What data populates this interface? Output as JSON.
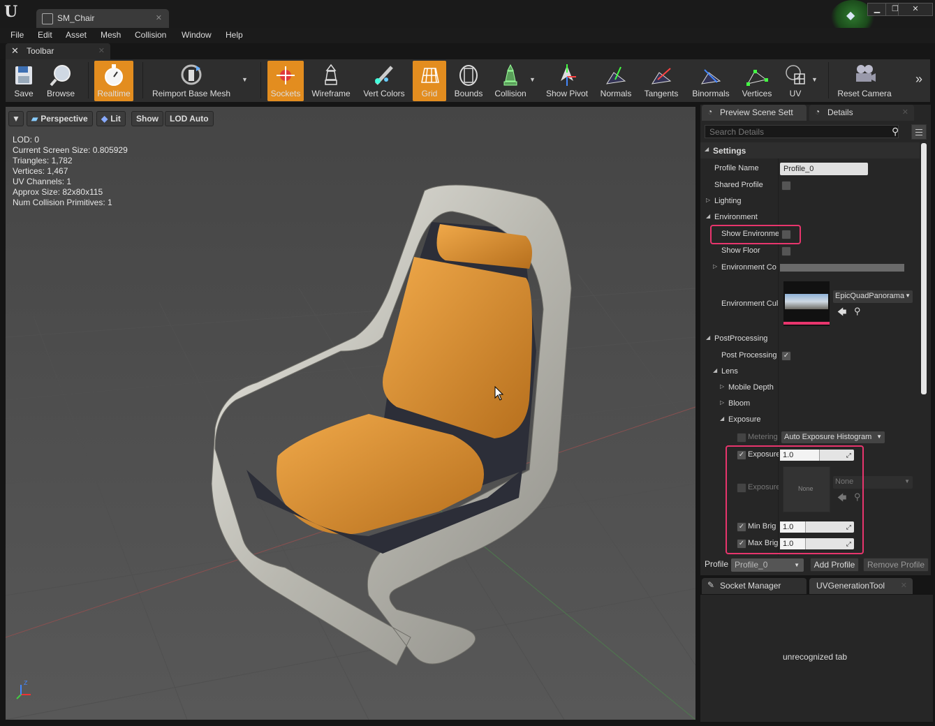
{
  "app": {
    "document_tab": "SM_Chair"
  },
  "menu": [
    "File",
    "Edit",
    "Asset",
    "Mesh",
    "Collision",
    "Window",
    "Help"
  ],
  "toolbar_tab": "Toolbar",
  "toolbar": [
    {
      "label": "Save",
      "icon": "save-icon",
      "active": false
    },
    {
      "label": "Browse",
      "icon": "browse-icon",
      "active": false
    },
    {
      "label": "Realtime",
      "icon": "realtime-icon",
      "active": true
    },
    {
      "label": "Reimport Base Mesh",
      "icon": "reimport-icon",
      "active": false
    },
    {
      "label": "Sockets",
      "icon": "sockets-icon",
      "active": true
    },
    {
      "label": "Wireframe",
      "icon": "wireframe-icon",
      "active": false
    },
    {
      "label": "Vert Colors",
      "icon": "vert-colors-icon",
      "active": false
    },
    {
      "label": "Grid",
      "icon": "grid-icon",
      "active": true
    },
    {
      "label": "Bounds",
      "icon": "bounds-icon",
      "active": false
    },
    {
      "label": "Collision",
      "icon": "collision-icon",
      "active": false
    },
    {
      "label": "Show Pivot",
      "icon": "pivot-icon",
      "active": false
    },
    {
      "label": "Normals",
      "icon": "normals-icon",
      "active": false
    },
    {
      "label": "Tangents",
      "icon": "tangents-icon",
      "active": false
    },
    {
      "label": "Binormals",
      "icon": "binormals-icon",
      "active": false
    },
    {
      "label": "Vertices",
      "icon": "vertices-icon",
      "active": false
    },
    {
      "label": "UV",
      "icon": "uv-icon",
      "active": false
    },
    {
      "label": "Reset Camera",
      "icon": "camera-icon",
      "active": false
    }
  ],
  "viewport": {
    "buttons": {
      "perspective": "Perspective",
      "lit": "Lit",
      "show": "Show",
      "lod": "LOD Auto"
    },
    "stats": [
      "LOD:  0",
      "Current Screen Size:  0.805929",
      "Triangles:  1,782",
      "Vertices:  1,467",
      "UV Channels:  1",
      "Approx Size: 82x80x115",
      "Num Collision Primitives:  1"
    ]
  },
  "panel": {
    "tabs": {
      "preview": "Preview Scene Sett",
      "details": "Details"
    },
    "search_placeholder": "Search Details",
    "settings_header": "Settings",
    "profile_name_label": "Profile Name",
    "profile_name_value": "Profile_0",
    "shared_profile_label": "Shared Profile",
    "lighting": "Lighting",
    "environment": "Environment",
    "show_environment": "Show Environme",
    "show_floor": "Show Floor",
    "environment_color": "Environment Co",
    "environment_cube": "Environment Cul",
    "cube_asset": "EpicQuadPanorama",
    "postprocessing": "PostProcessing",
    "post_processing_enabled": "Post Processing",
    "lens": "Lens",
    "mobile_depth": "Mobile Depth",
    "bloom": "Bloom",
    "exposure": "Exposure",
    "metering": "Metering",
    "metering_value": "Auto Exposure Histogram",
    "exposure_comp": "Exposure",
    "exposure_comp_value": "1.0",
    "exposure_curve": "Exposure",
    "curve_thumb": "None",
    "curve_select": "None",
    "min_brightness": "Min Brig",
    "min_value": "1.0",
    "max_brightness": "Max Brig",
    "max_value": "1.0"
  },
  "profile_bar": {
    "label": "Profile",
    "value": "Profile_0",
    "add": "Add Profile",
    "remove": "Remove Profile"
  },
  "bottom_panel": {
    "tab1": "Socket Manager",
    "tab2": "UVGenerationTool",
    "message": "unrecognized tab"
  },
  "colors": {
    "accent": "#e38d1f",
    "highlight": "#e8356d",
    "seat": "#d98b2b"
  }
}
